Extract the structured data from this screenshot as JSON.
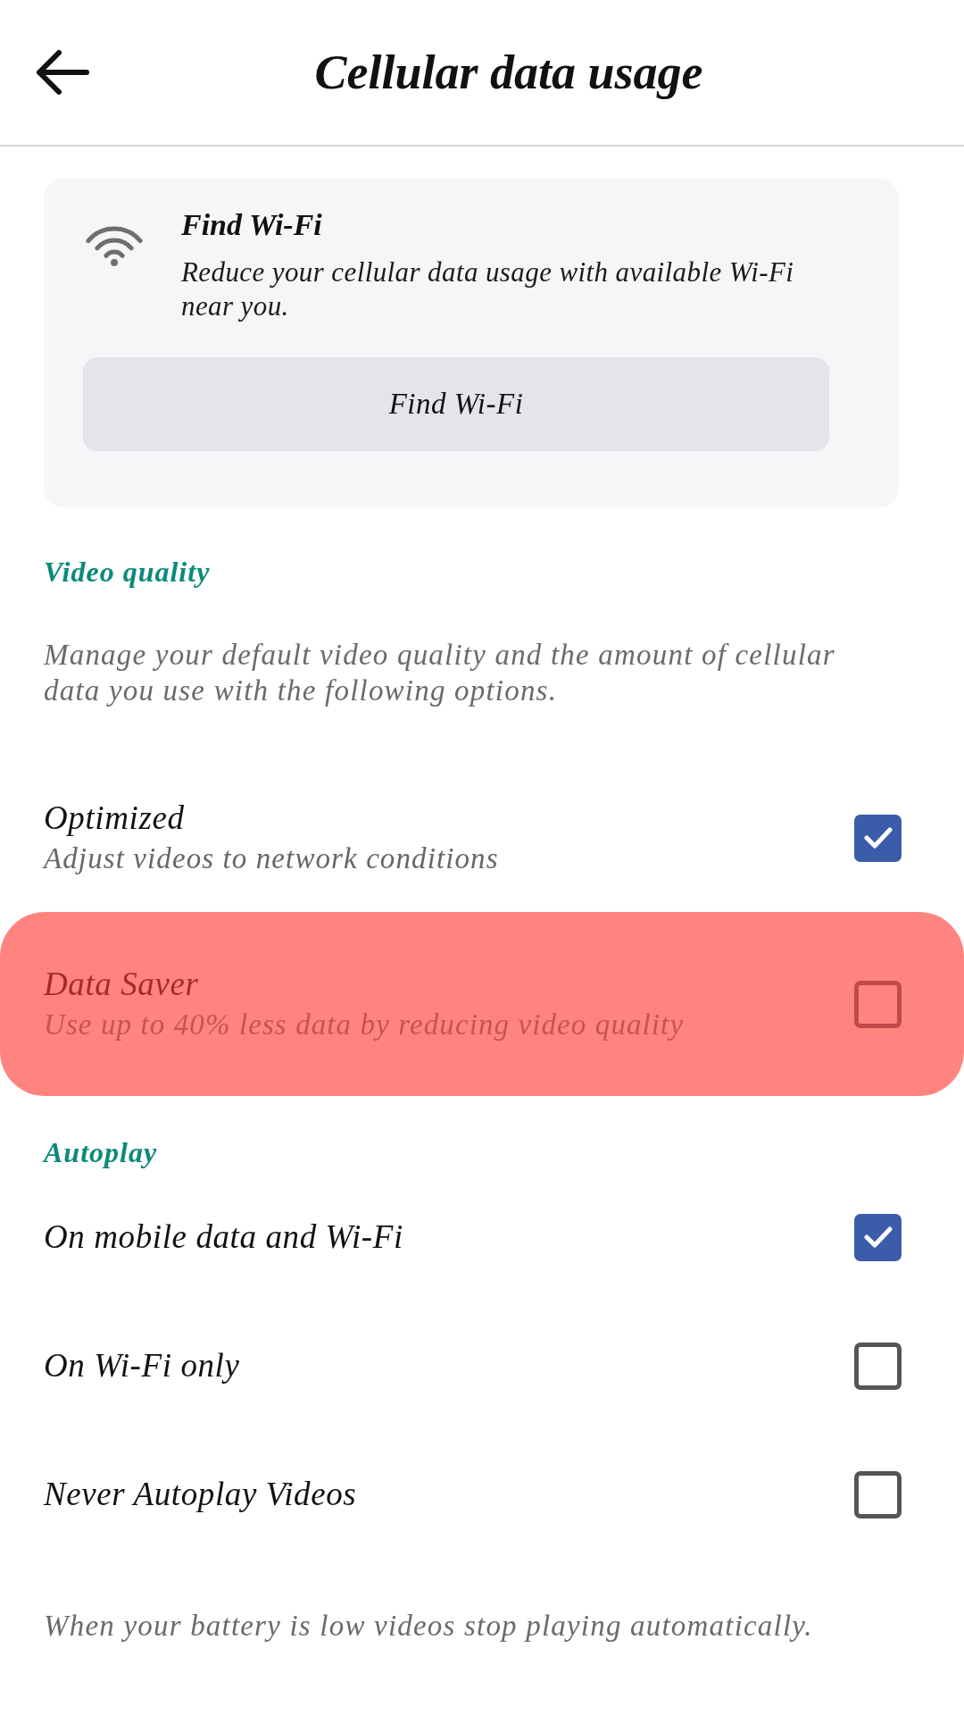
{
  "header": {
    "title": "Cellular data usage"
  },
  "wifi_card": {
    "title": "Find Wi-Fi",
    "description": "Reduce your cellular data usage with available Wi-Fi near you.",
    "button": "Find Wi-Fi"
  },
  "sections": [
    {
      "heading": "Video quality",
      "description": "Manage your default video quality and the amount of cellular data you use with the following options.",
      "options": [
        {
          "label": "Optimized",
          "sublabel": "Adjust videos to network conditions",
          "checked": true,
          "highlighted": false
        },
        {
          "label": "Data Saver",
          "sublabel": "Use up to 40% less data by reducing video quality",
          "checked": false,
          "highlighted": true
        }
      ]
    },
    {
      "heading": "Autoplay",
      "options": [
        {
          "label": "On mobile data and Wi-Fi",
          "checked": true,
          "highlighted": false
        },
        {
          "label": "On Wi-Fi only",
          "checked": false,
          "highlighted": false
        },
        {
          "label": "Never Autoplay Videos",
          "checked": false,
          "highlighted": false
        }
      ],
      "note": "When your battery is low videos stop playing automatically."
    }
  ]
}
